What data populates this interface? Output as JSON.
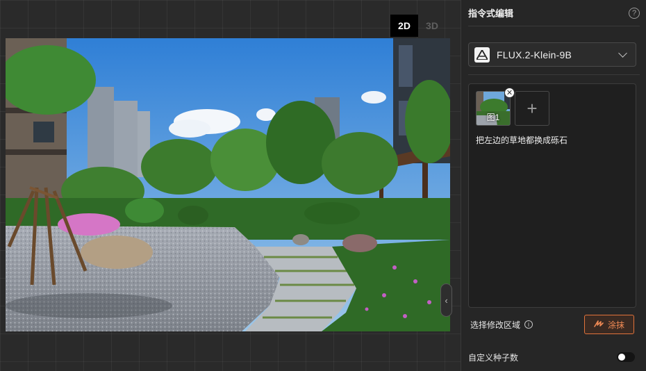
{
  "canvas": {
    "view_modes": [
      {
        "label": "2D",
        "active": true
      },
      {
        "label": "3D",
        "active": false
      }
    ],
    "collapse_icon": "chevron-left-icon"
  },
  "panel": {
    "title": "指令式编辑",
    "help_icon": "question-icon",
    "model": {
      "name": "FLUX.2-Klein-9B",
      "logo_icon": "flux-logo-icon"
    },
    "reference_images": [
      {
        "label": "图1"
      }
    ],
    "add_icon": "plus-icon",
    "prompt": "把左边的草地都换成砾石",
    "region": {
      "label": "选择修改区域",
      "info_icon": "info-icon",
      "paint_button": "涂抹",
      "paint_icon": "brush-icon"
    },
    "seed": {
      "label": "自定义种子数",
      "enabled": false
    }
  },
  "colors": {
    "accent": "#e2733b",
    "panel_bg": "#262626",
    "canvas_bg": "#2a2a2a"
  }
}
